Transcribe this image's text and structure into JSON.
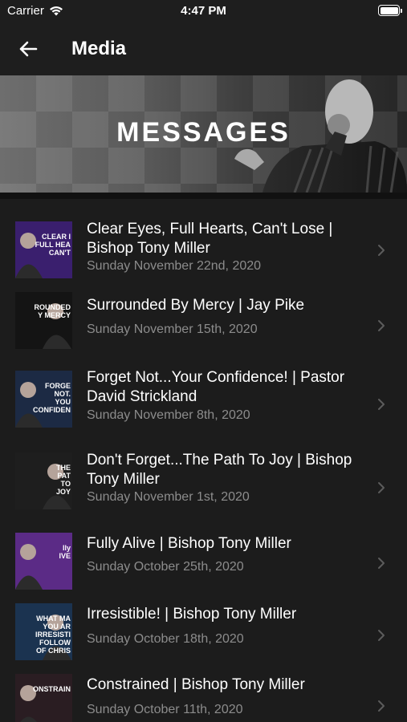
{
  "status_bar": {
    "carrier": "Carrier",
    "time": "4:47 PM"
  },
  "nav": {
    "title": "Media"
  },
  "banner": {
    "title": "MESSAGES"
  },
  "items": [
    {
      "title": "Clear Eyes, Full Hearts, Can't Lose | Bishop Tony Miller",
      "date": "Sunday November 22nd, 2020",
      "thumb_text": "CLEAR I\nFULL HEA\nCAN'T",
      "thumb_bg": "#3a1f6e"
    },
    {
      "title": "Surrounded By Mercy | Jay Pike",
      "date": "Sunday November 15th, 2020",
      "thumb_text": "ROUNDED\nY MERCY",
      "thumb_bg": "#141414"
    },
    {
      "title": "Forget Not...Your Confidence! | Pastor David Strickland",
      "date": "Sunday November 8th, 2020",
      "thumb_text": "FORGE\nNOT.\nYOU\nCONFIDEN",
      "thumb_bg": "#1c2a44"
    },
    {
      "title": "Don't Forget...The Path To Joy | Bishop Tony Miller",
      "date": "Sunday November 1st, 2020",
      "thumb_text": "THE\nPAT\nTO\nJOY",
      "thumb_bg": "#1e1e1e"
    },
    {
      "title": "Fully Alive | Bishop Tony Miller",
      "date": "Sunday October 25th, 2020",
      "thumb_text": "lly\nIVE",
      "thumb_bg": "#5b2b86"
    },
    {
      "title": "Irresistible! | Bishop Tony Miller",
      "date": "Sunday October 18th, 2020",
      "thumb_text": "WHAT MA\nYOU AR\nIRRESISTI\nFOLLOW\nOF CHRIS",
      "thumb_bg": "#1b3350"
    },
    {
      "title": "Constrained | Bishop Tony Miller",
      "date": "Sunday October 11th, 2020",
      "thumb_text": "ONSTRAIN",
      "thumb_bg": "#2a1d22"
    }
  ]
}
